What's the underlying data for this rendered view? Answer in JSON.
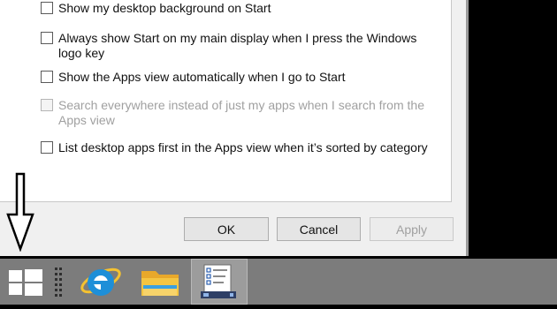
{
  "options": [
    {
      "label": "Show my desktop background on Start",
      "checked": false,
      "disabled": false
    },
    {
      "label": "Always show Start on my main display when I press the Windows logo key",
      "checked": false,
      "disabled": false
    },
    {
      "label": "Show the Apps view automatically when I go to Start",
      "checked": false,
      "disabled": false
    },
    {
      "label": "Search everywhere instead of just my apps when I search from the Apps view",
      "checked": false,
      "disabled": true
    },
    {
      "label": "List desktop apps first in the Apps view when it’s sorted by category",
      "checked": false,
      "disabled": false
    }
  ],
  "buttons": {
    "ok": "OK",
    "cancel": "Cancel",
    "apply": "Apply"
  },
  "taskbar": {
    "items": [
      {
        "icon": "windows-logo-icon"
      },
      {
        "icon": "internet-explorer-icon"
      },
      {
        "icon": "file-explorer-icon"
      },
      {
        "icon": "taskbar-properties-icon",
        "active": true
      }
    ]
  },
  "colors": {
    "taskbar": "#7c7c7c",
    "dialog": "#f0f0f0",
    "ie_blue": "#1e8fd8",
    "folder_yellow": "#f4c542"
  }
}
